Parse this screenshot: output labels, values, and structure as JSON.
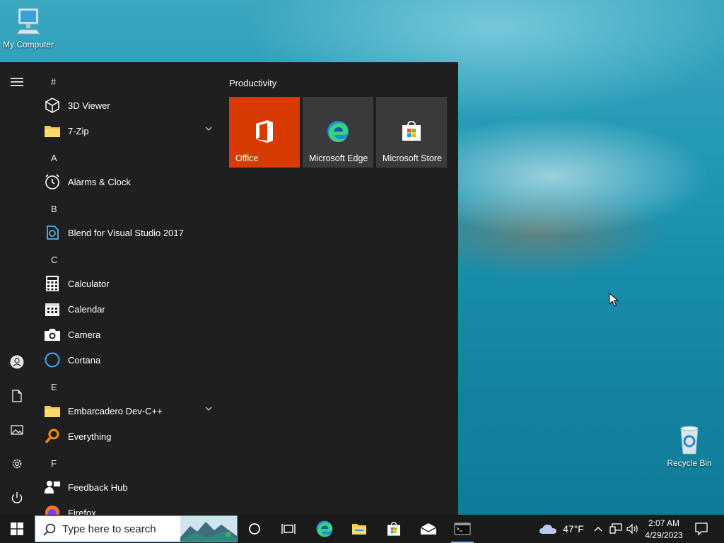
{
  "desktop": {
    "icons": [
      {
        "label": "My Computer",
        "icon": "computer-icon"
      },
      {
        "label": "Recycle Bin",
        "icon": "recycle-bin-icon"
      }
    ]
  },
  "start_menu": {
    "rail": [
      "hamburger-icon",
      "user-icon",
      "documents-icon",
      "pictures-icon",
      "settings-icon",
      "power-icon"
    ],
    "groups": [
      {
        "letter": "#",
        "apps": [
          {
            "label": "3D Viewer",
            "icon": "3d-viewer-icon"
          },
          {
            "label": "7-Zip",
            "icon": "folder-icon",
            "expandable": true
          }
        ]
      },
      {
        "letter": "A",
        "apps": [
          {
            "label": "Alarms & Clock",
            "icon": "alarm-clock-icon"
          }
        ]
      },
      {
        "letter": "B",
        "apps": [
          {
            "label": "Blend for Visual Studio 2017",
            "icon": "blend-icon"
          }
        ]
      },
      {
        "letter": "C",
        "apps": [
          {
            "label": "Calculator",
            "icon": "calculator-icon"
          },
          {
            "label": "Calendar",
            "icon": "calendar-icon"
          },
          {
            "label": "Camera",
            "icon": "camera-icon"
          },
          {
            "label": "Cortana",
            "icon": "cortana-icon"
          }
        ]
      },
      {
        "letter": "E",
        "apps": [
          {
            "label": "Embarcadero Dev-C++",
            "icon": "folder-icon",
            "expandable": true
          },
          {
            "label": "Everything",
            "icon": "everything-search-icon"
          }
        ]
      },
      {
        "letter": "F",
        "apps": [
          {
            "label": "Feedback Hub",
            "icon": "feedback-hub-icon"
          },
          {
            "label": "Firefox",
            "icon": "firefox-icon"
          }
        ]
      }
    ],
    "tiles_group_title": "Productivity",
    "tiles": [
      {
        "label": "Office",
        "icon": "office-icon",
        "color": "#d83b01"
      },
      {
        "label": "Microsoft Edge",
        "icon": "edge-icon",
        "color": "#3a3a3a"
      },
      {
        "label": "Microsoft Store",
        "icon": "store-icon",
        "color": "#3a3a3a"
      }
    ]
  },
  "taskbar": {
    "search_placeholder": "Type here to search",
    "pinned": [
      "cortana-icon",
      "task-view-icon",
      "edge-icon",
      "file-explorer-icon",
      "store-icon",
      "mail-icon",
      "terminal-icon"
    ],
    "weather": {
      "temp": "47°F",
      "icon": "cloud-icon"
    },
    "clock": {
      "time": "2:07 AM",
      "date": "4/29/2023"
    }
  },
  "colors": {
    "taskbar": "#1a1a1a",
    "start_menu": "#1f1f1f",
    "office_tile": "#d83b01",
    "tile": "#3a3a3a"
  }
}
